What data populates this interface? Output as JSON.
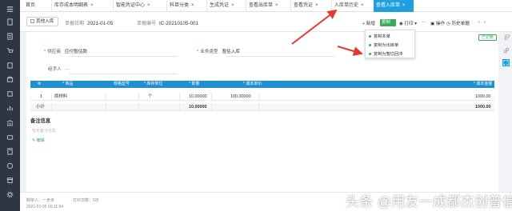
{
  "tabs": [
    {
      "label": "首页",
      "closable": false
    },
    {
      "label": "库存成本明细表",
      "closable": true
    },
    {
      "label": "智能凭证中心",
      "closable": true
    },
    {
      "label": "科目分类",
      "closable": true
    },
    {
      "label": "生成凭证",
      "closable": true
    },
    {
      "label": "查看出库单",
      "closable": true
    },
    {
      "label": "查看凭证",
      "closable": true
    },
    {
      "label": "入库单历史",
      "closable": true
    },
    {
      "label": "查看入库单",
      "closable": true,
      "active": true
    }
  ],
  "close_glyph": "×",
  "header": {
    "doc_type": "其他入库",
    "date_label": "单据日期",
    "date_value": "2021-01-05",
    "number_label": "单据编号",
    "number_value": "IC-20210105-001",
    "toolbar": {
      "new": "新增",
      "copy": "复制",
      "print": "打印",
      "more": "···",
      "operate": "操作",
      "history": "历史单据"
    },
    "status": "已记账"
  },
  "copy_menu": {
    "items": [
      "复制本单",
      "复制为出库单",
      "复制为暂估回冲"
    ]
  },
  "form": {
    "supplier_label": "供应商",
    "supplier_value": "应付暂估款",
    "biztype_label": "业务类型",
    "biztype_value": "暂估入库",
    "handler_label": "经手人",
    "handler_value": "···"
  },
  "table": {
    "columns": [
      "",
      "商品",
      "规格型号",
      "库存单位",
      "数量",
      "成本单价",
      "成本金额"
    ],
    "required_marker": "*",
    "rows": [
      {
        "index": "1",
        "product": "原材料",
        "spec": "",
        "unit": "个",
        "qty": "10.00000",
        "price": "100.00000",
        "amount": "1000.00"
      }
    ],
    "summary": {
      "label": "小计",
      "qty": "10.00000",
      "amount": "1000.00"
    }
  },
  "remarks": {
    "title": "备注信息",
    "placeholder": "暂无备注信息",
    "edit_link": "编辑"
  },
  "footer": {
    "creator_label": "制单人：",
    "creator_value": "一步步",
    "print_label": "打印次数：",
    "print_value": "0次",
    "timestamp": "2021-01-05 00:11:54"
  },
  "watermark": "头条 @用友一成都杰创普信",
  "colors": {
    "accent": "#1fa0de",
    "green": "#3aaa5b",
    "nav_bg": "#2f3542",
    "arrow": "#e53935"
  }
}
